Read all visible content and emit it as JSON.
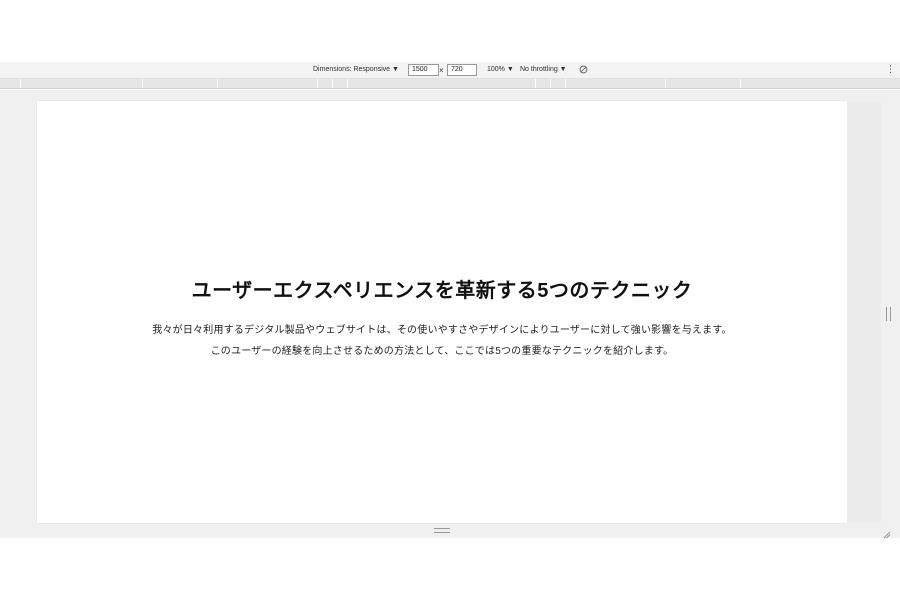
{
  "device_toolbar": {
    "dimensions_label": "Dimensions: Responsive ▼",
    "width_value": "1500",
    "times_symbol": "×",
    "height_value": "720",
    "zoom_label": "100% ▼",
    "throttling_label": "No throttling ▼",
    "rotate_icon": "rotate-icon",
    "more_icon": "⋮"
  },
  "page": {
    "title": "ユーザーエクスペリエンスを革新する5つのテクニック",
    "description_line_1": "我々が日々利用するデジタル製品やウェブサイトは、その使いやすさやデザインによりユーザーに対して強い影響を与えます。",
    "description_line_2": "このユーザーの経験を向上させるための方法として、ここでは5つの重要なテクニックを紹介します。"
  }
}
